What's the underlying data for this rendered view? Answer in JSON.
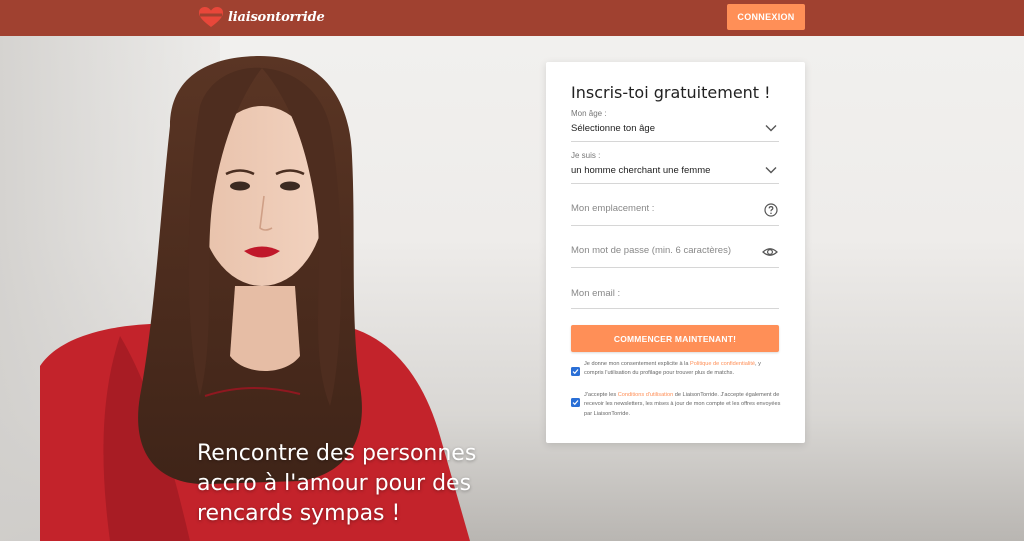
{
  "header": {
    "logo_text": "liaisontorride",
    "login_label": "CONNEXION"
  },
  "hero": {
    "tagline": "Rencontre des personnes accro à l'amour pour des rencards sympas !"
  },
  "form": {
    "title": "Inscris-toi gratuitement !",
    "age": {
      "label": "Mon âge :",
      "value": "Sélectionne ton âge"
    },
    "gender": {
      "label": "Je suis :",
      "value": "un homme cherchant une femme"
    },
    "location": {
      "placeholder": "Mon emplacement :"
    },
    "password": {
      "placeholder": "Mon mot de passe (min. 6 caractères)"
    },
    "email": {
      "placeholder": "Mon email :"
    },
    "submit_label": "COMMENCER MAINTENANT!",
    "consent1": {
      "checked": true,
      "text_before": "Je donne mon consentement explicite à la ",
      "link": "Politique de confidentialité",
      "text_after": ", y compris l'utilisation du profilage pour trouver plus de matchs."
    },
    "consent2": {
      "checked": true,
      "text_before": "J'accepte les ",
      "link": "Conditions d'utilisation",
      "text_after": " de LiaisonTorride. J'accepte également de recevoir les newsletters, les mises à jour de mon compte et les offres envoyées par LiaisonTorride."
    }
  },
  "colors": {
    "header": "#a04130",
    "accent": "#ff8f57",
    "checkbox": "#2a6fd6"
  },
  "icons": {
    "logo": "heart-logo-icon",
    "select_arrow": "chevron-down-icon",
    "location_help": "question-circle-icon",
    "password_toggle": "eye-icon"
  }
}
